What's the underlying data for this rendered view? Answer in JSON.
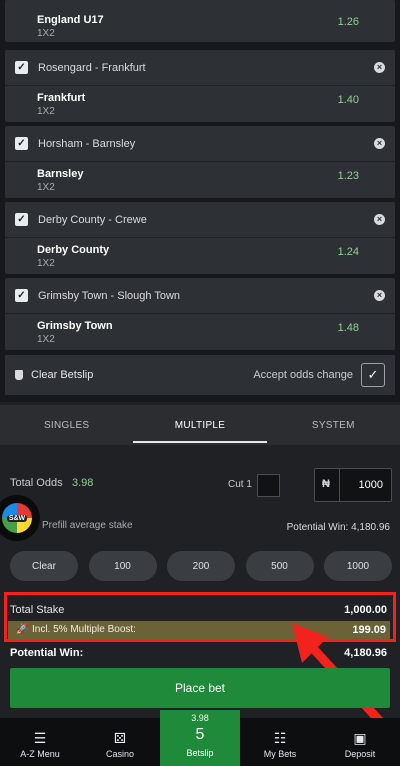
{
  "bets": [
    {
      "match": "",
      "selection": "England U17",
      "market": "1X2",
      "odds": "1.26"
    },
    {
      "match": "Rosengard - Frankfurt",
      "selection": "Frankfurt",
      "market": "1X2",
      "odds": "1.40"
    },
    {
      "match": "Horsham - Barnsley",
      "selection": "Barnsley",
      "market": "1X2",
      "odds": "1.23"
    },
    {
      "match": "Derby County - Crewe",
      "selection": "Derby County",
      "market": "1X2",
      "odds": "1.24"
    },
    {
      "match": "Grimsby Town - Slough Town",
      "selection": "Grimsby Town",
      "market": "1X2",
      "odds": "1.48"
    }
  ],
  "clear_betslip": "Clear Betslip",
  "accept_odds": "Accept odds change",
  "tabs": [
    "SINGLES",
    "MULTIPLE",
    "SYSTEM"
  ],
  "active_tab": "MULTIPLE",
  "total_odds_label": "Total Odds",
  "total_odds_value": "3.98",
  "cut_label": "Cut 1",
  "currency_symbol": "₦",
  "stake_value": "1000",
  "prefill_label": "Prefill average stake",
  "potential_win_small": "Potential Win: 4,180.96",
  "quick_stakes": [
    "Clear",
    "100",
    "200",
    "500",
    "1000"
  ],
  "total_stake_label": "Total Stake",
  "total_stake_value": "1,000.00",
  "boost_label": "Incl. 5% Multiple Boost:",
  "boost_value": "199.09",
  "potential_win_label": "Potential Win:",
  "potential_win_value": "4,180.96",
  "place_bet": "Place bet",
  "nav": {
    "az": "A-Z Menu",
    "casino": "Casino",
    "betslip_odds": "3.98",
    "betslip_count": "5",
    "betslip": "Betslip",
    "mybets": "My Bets",
    "deposit": "Deposit"
  },
  "colors": {
    "odds_green": "#8fd38f",
    "place_bet_green": "#1f8a3a",
    "highlight_red": "#f2221d",
    "boost_bg": "#6b6238"
  }
}
